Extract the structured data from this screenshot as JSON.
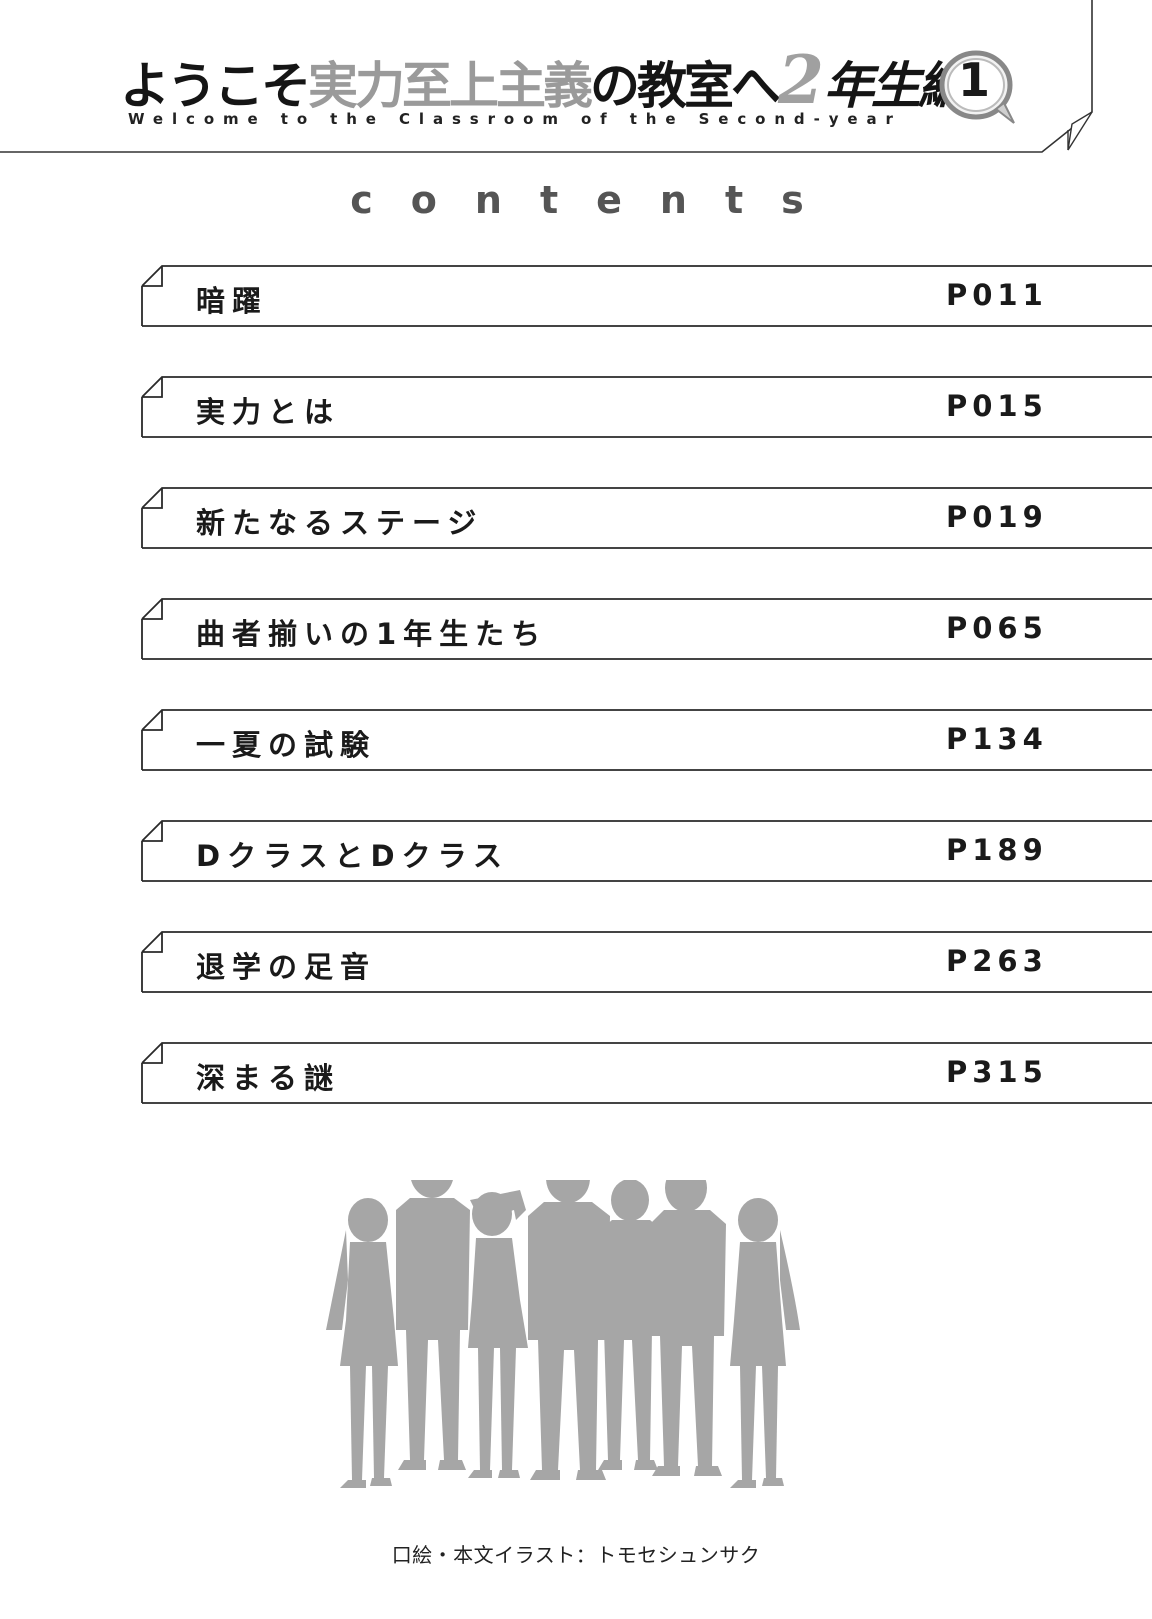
{
  "header": {
    "title_part1": "ようこそ",
    "title_part2": "実力至上主義",
    "title_part3": "の教室へ",
    "title_part4": "2",
    "title_part5": "年生編",
    "volume": "1",
    "subtitle": "Welcome to the Classroom of the Second-year"
  },
  "contents_heading": "contents",
  "toc": [
    {
      "title": "暗躍",
      "page": "P011"
    },
    {
      "title": "実力とは",
      "page": "P015"
    },
    {
      "title": "新たなるステージ",
      "page": "P019"
    },
    {
      "title": "曲者揃いの1年生たち",
      "page": "P065"
    },
    {
      "title": "一夏の試験",
      "page": "P134"
    },
    {
      "title": "DクラスとDクラス",
      "page": "P189"
    },
    {
      "title": "退学の足音",
      "page": "P263"
    },
    {
      "title": "深まる謎",
      "page": "P315"
    }
  ],
  "credit": "口絵・本文イラスト：トモセシュンサク"
}
